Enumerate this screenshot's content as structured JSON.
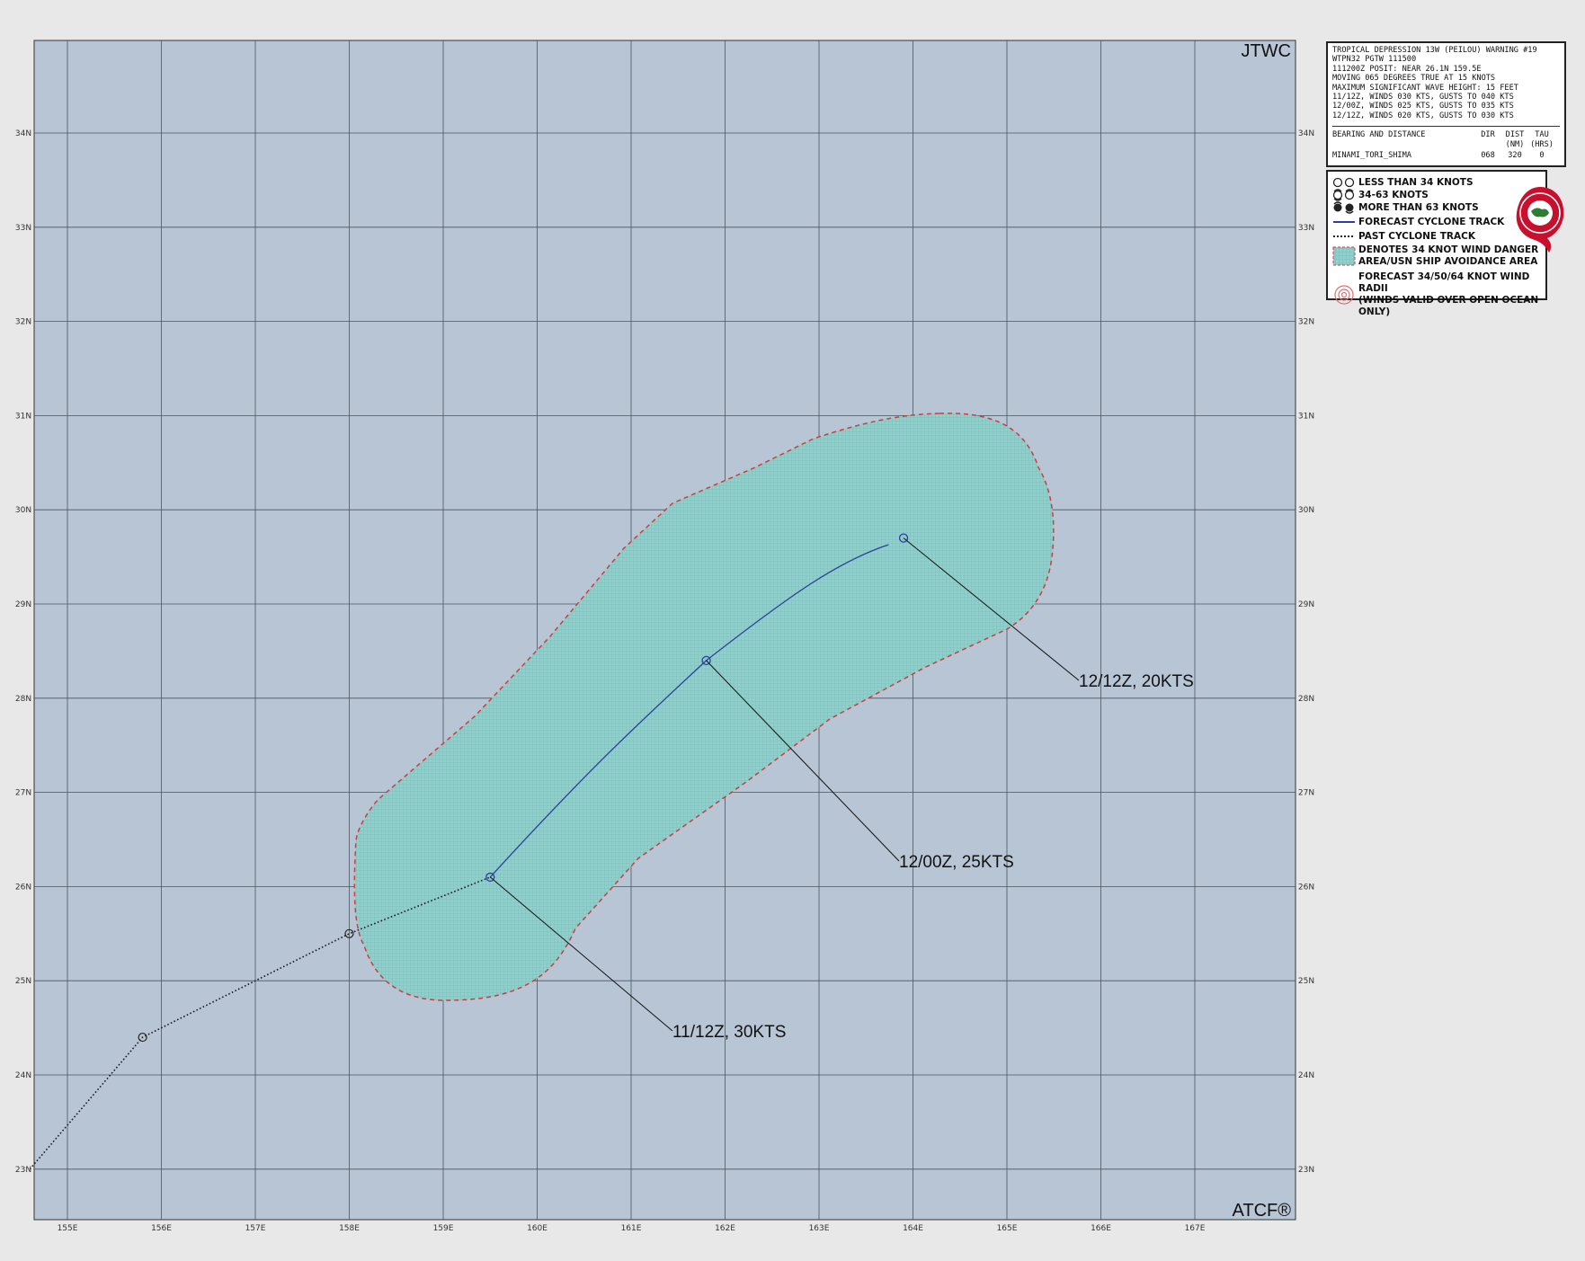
{
  "corner_labels": {
    "top_right": "JTWC",
    "bottom_right": "ATCF®"
  },
  "info_box": {
    "lines": [
      "TROPICAL DEPRESSION 13W (PEILOU) WARNING #19",
      "WTPN32 PGTW 111500",
      "111200Z POSIT: NEAR 26.1N 159.5E",
      "MOVING 065 DEGREES TRUE AT 15 KNOTS",
      "MAXIMUM SIGNIFICANT WAVE HEIGHT: 15 FEET",
      "11/12Z, WINDS 030 KTS, GUSTS TO 040 KTS",
      "12/00Z, WINDS 025 KTS, GUSTS TO 035 KTS",
      "12/12Z, WINDS 020 KTS, GUSTS TO 030 KTS"
    ],
    "bearing_header": {
      "label": "BEARING AND DISTANCE",
      "dir": "DIR",
      "dist": "DIST",
      "dist_unit": "(NM)",
      "trav": "TAU",
      "trav_unit": "(HRS)"
    },
    "bearing_row": {
      "place": "MINAMI_TORI_SHIMA",
      "dir": "068",
      "dist": "320",
      "tau": "0"
    }
  },
  "legend": {
    "items": [
      {
        "icon": "circle-less-than-34kt-icon",
        "label": "LESS THAN 34 KNOTS"
      },
      {
        "icon": "storm-34-63kt-icon",
        "label": "34-63 KNOTS"
      },
      {
        "icon": "storm-more-than-63kt-icon",
        "label": "MORE THAN 63 KNOTS"
      },
      {
        "icon": "forecast-track-line-icon",
        "label": "FORECAST CYCLONE TRACK"
      },
      {
        "icon": "past-track-line-icon",
        "label": "PAST CYCLONE TRACK"
      },
      {
        "icon": "danger-area-swatch-icon",
        "label": "DENOTES 34 KNOT WIND DANGER",
        "label2": "AREA/USN SHIP AVOIDANCE AREA"
      },
      {
        "icon": "wind-radii-icon",
        "label": "FORECAST 34/50/64 KNOT WIND RADII",
        "label2": "(WINDS VALID OVER OPEN OCEAN ONLY)"
      }
    ],
    "colors": {
      "forecast_track": "#2b3f9e",
      "danger_fill": "#8fd0cc",
      "danger_border": "#d43a3a",
      "logo_red": "#c8102e"
    }
  },
  "map": {
    "lon_ticks": [
      "155E",
      "156E",
      "157E",
      "158E",
      "159E",
      "160E",
      "161E",
      "162E",
      "163E",
      "164E",
      "165E",
      "166E",
      "167E"
    ],
    "lat_ticks": [
      "23N",
      "24N",
      "25N",
      "26N",
      "27N",
      "28N",
      "29N",
      "30N",
      "31N",
      "32N",
      "33N",
      "34N"
    ],
    "colors": {
      "ocean": "#b7c5d5",
      "grid": "#4a5560"
    },
    "past_track": [
      {
        "lon": 154.6,
        "lat": 23.0
      },
      {
        "lon": 155.8,
        "lat": 24.4
      },
      {
        "lon": 158.0,
        "lat": 25.5
      },
      {
        "lon": 159.5,
        "lat": 26.1
      }
    ],
    "past_positions": [
      {
        "lon": 155.8,
        "lat": 24.4
      },
      {
        "lon": 158.0,
        "lat": 25.5
      }
    ],
    "forecast_points": [
      {
        "lon": 159.5,
        "lat": 26.1,
        "label": "11/12Z,  30KTS"
      },
      {
        "lon": 161.8,
        "lat": 28.4,
        "label": "12/00Z,  25KTS"
      },
      {
        "lon": 163.9,
        "lat": 29.7,
        "label": "12/12Z,  20KTS"
      }
    ]
  }
}
